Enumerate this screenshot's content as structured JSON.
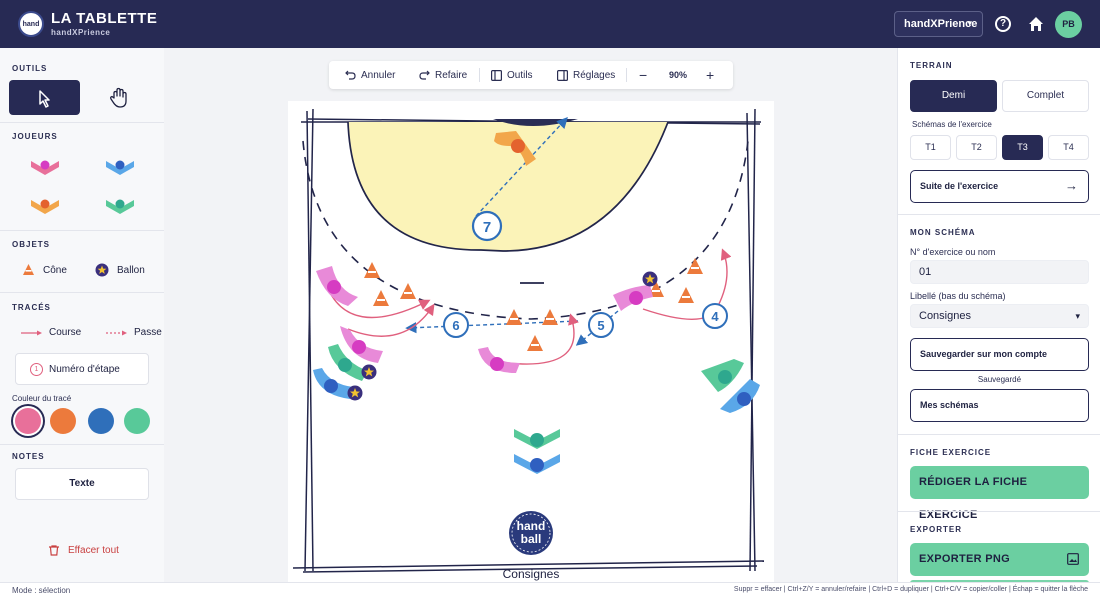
{
  "app": {
    "title": "LA TABLETTE",
    "subtitle": "handXPrience",
    "logo_text_1": "hand",
    "logo_text_2": "ball"
  },
  "topbar": {
    "brand_select": "handXPrience",
    "avatar": "PB",
    "help": "?"
  },
  "left": {
    "sections": {
      "tools": "OUTILS",
      "players": "JOUEURS",
      "objects": "OBJETS",
      "traces": "TRACÉS",
      "notes": "NOTES"
    },
    "objects": [
      {
        "label": "Cône",
        "icon": "cone-icon"
      },
      {
        "label": "Ballon",
        "icon": "ball-icon"
      }
    ],
    "traces": [
      {
        "label": "Course",
        "color": "#e0607e"
      },
      {
        "label": "Passe",
        "color": "#e0607e"
      }
    ],
    "step_button": {
      "number": "1",
      "label": "Numéro d'étape"
    },
    "color_label": "Couleur du tracé",
    "colors": [
      "#e8709a",
      "#ec7a3c",
      "#2f6fba",
      "#58c999"
    ],
    "text_button": "Texte",
    "clear_button": "Effacer tout"
  },
  "toolbar": {
    "undo": "Annuler",
    "redo": "Refaire",
    "tools": "Outils",
    "settings": "Réglages",
    "zoom": "90%"
  },
  "court": {
    "caption": "Consignes",
    "numbers": [
      "7",
      "6",
      "5",
      "4"
    ]
  },
  "right": {
    "terrain_label": "TERRAIN",
    "terrain_options": [
      "Demi",
      "Complet"
    ],
    "schemas_label": "Schémas de l'exercice",
    "schemas": [
      "T1",
      "T2",
      "T3",
      "T4"
    ],
    "next_button": "Suite de l'exercice",
    "my_schema_label": "MON SCHÉMA",
    "exercise_field_label": "N° d'exercice ou nom",
    "exercise_field_value": "01",
    "caption_label": "Libellé (bas du schéma)",
    "caption_value": "Consignes",
    "save_button": "Sauvegarder sur mon compte",
    "saved_text": "Sauvegardé",
    "my_schemas_button": "Mes schémas",
    "sheet_label": "FICHE EXERCICE",
    "sheet_button": "RÉDIGER LA FICHE EXERCICE",
    "export_label": "EXPORTER",
    "export_button": "EXPORTER PNG"
  },
  "status": {
    "mode": "Mode : sélection",
    "hints": "Suppr = effacer  |  Ctrl+Z/Y = annuler/refaire  |  Ctrl+D = dupliquer  |  Ctrl+C/V = copier/coller  |  Échap = quitter la flèche"
  }
}
